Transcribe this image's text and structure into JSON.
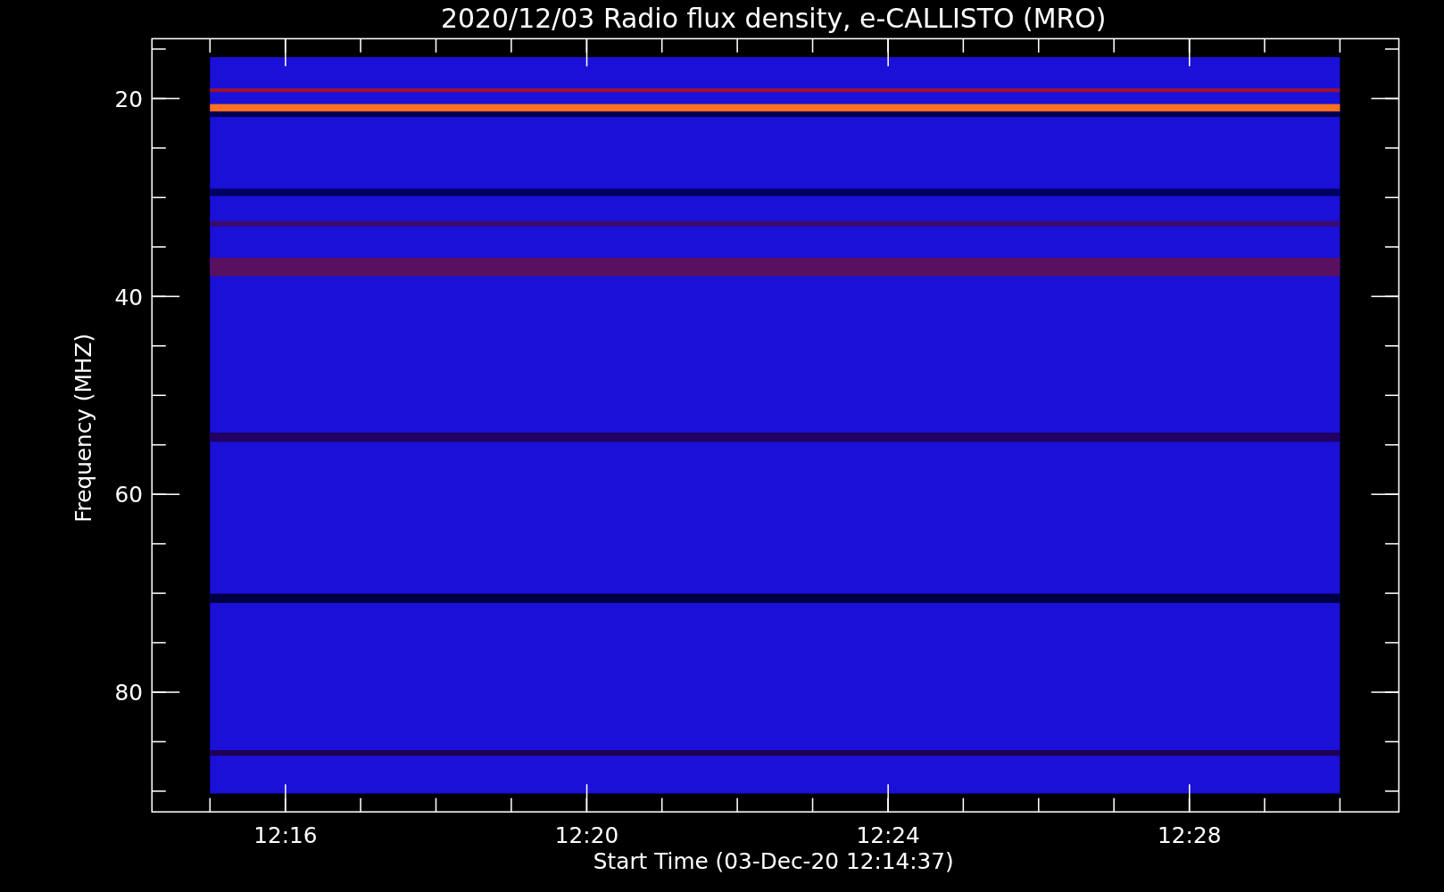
{
  "title": "2020/12/03  Radio flux density, e-CALLISTO (MRO)",
  "y_axis": {
    "label": "Frequency (MHZ)",
    "ticks": [
      "20",
      "40",
      "60",
      "80"
    ]
  },
  "x_axis": {
    "label": "Start Time (03-Dec-20 12:14:37)",
    "ticks": [
      "12:16",
      "12:20",
      "12:24",
      "12:28"
    ]
  }
}
